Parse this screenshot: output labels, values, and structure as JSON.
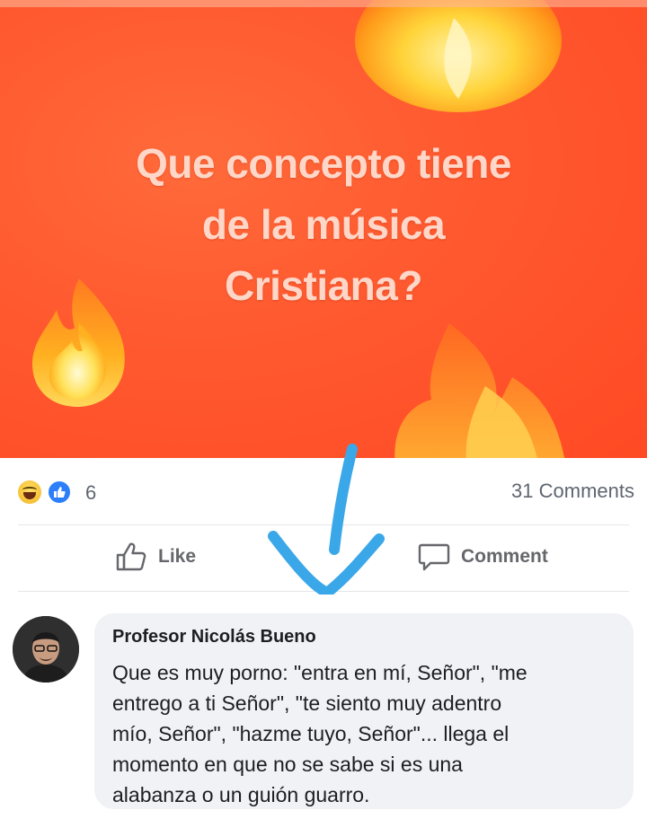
{
  "post": {
    "text_lines": [
      "Que concepto tiene",
      "de la música",
      "Cristiana?"
    ],
    "background_color": "#ff5a30"
  },
  "reactions": {
    "icons": [
      "haha-reaction-icon",
      "like-reaction-icon"
    ],
    "count": "6",
    "comments_count": "31 Comments"
  },
  "actions": {
    "like_label": "Like",
    "comment_label": "Comment"
  },
  "comment": {
    "author": "Profesor Nicolás Bueno",
    "text_lines": [
      "Que es muy porno: \"entra en mí, Señor\", \"me",
      "entrego a ti Señor\", \"te siento muy adentro",
      "mío, Señor\", \"hazme tuyo, Señor\"... llega el",
      "momento en que no se sabe si es una",
      "alabanza o un guión guarro."
    ]
  },
  "colors": {
    "accent_blue": "#2d7ff9",
    "arrow_blue": "#3aa7e8",
    "muted_text": "#65676b"
  }
}
